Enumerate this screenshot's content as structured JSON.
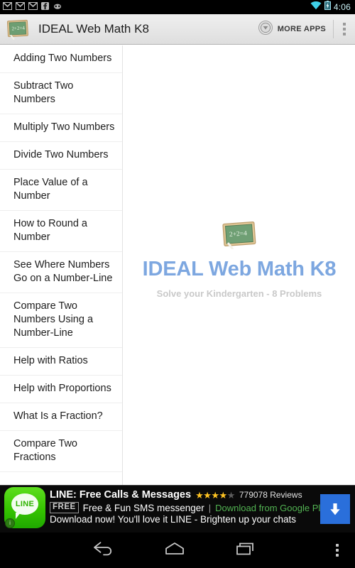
{
  "status_bar": {
    "notification_icons": [
      "gmail-icon",
      "gmail-icon",
      "gmail-icon",
      "facebook-icon",
      "cyanogenmod-icon"
    ],
    "wifi_icon": "wifi-icon",
    "battery_icon": "battery-charging-icon",
    "clock": "4:06",
    "clock_color": "#c9f2f7"
  },
  "action_bar": {
    "logo_icon": "chalkboard-app-icon",
    "title": "IDEAL Web Math K8",
    "more_apps_label": "MORE APPS",
    "more_apps_icon": "circle-chevron-down-icon",
    "overflow_icon": "overflow-menu-icon",
    "background_color": "#e6e6e6"
  },
  "sidebar": {
    "items": [
      {
        "label": "Adding Two Numbers"
      },
      {
        "label": "Subtract Two Numbers"
      },
      {
        "label": "Multiply Two Numbers"
      },
      {
        "label": "Divide Two Numbers"
      },
      {
        "label": "Place Value of a Number"
      },
      {
        "label": "How to Round a Number"
      },
      {
        "label": "See Where Numbers Go on a Number-Line"
      },
      {
        "label": "Compare Two Numbers Using a Number-Line"
      },
      {
        "label": "Help with Ratios"
      },
      {
        "label": "Help with Proportions"
      },
      {
        "label": "What Is a Fraction?"
      },
      {
        "label": "Compare Two Fractions"
      }
    ]
  },
  "main": {
    "hero_logo_icon": "chalkboard-logo",
    "hero_chalk_text": "2+2=4",
    "title": "IDEAL Web Math K8",
    "title_color": "#7da7e0",
    "subtitle": "Solve your Kindergarten - 8 Problems",
    "subtitle_color": "#c9c9c9"
  },
  "ad": {
    "app_icon": "line-app-icon",
    "app_icon_label": "LINE",
    "adchoices_icon": "adchoices-icon",
    "adchoices_glyph": "i",
    "headline": "LINE: Free Calls & Messages",
    "stars_filled": 4,
    "stars_total": 5,
    "star_glyph": "★",
    "star_color": "#ffc422",
    "reviews": "779078 Reviews",
    "price_badge": "FREE",
    "description": "Free & Fun SMS messenger",
    "separator": "|",
    "store_link": "Download from Google Play",
    "store_link_color": "#52b352",
    "tagline": "Download now! You'll love it LINE - Brighten up your chats",
    "cta_icon": "download-arrow-icon",
    "cta_color": "#2a6fdb"
  },
  "nav_bar": {
    "back_icon": "back-icon",
    "home_icon": "home-icon",
    "recents_icon": "recent-apps-icon",
    "overflow_icon": "overflow-menu-icon"
  }
}
